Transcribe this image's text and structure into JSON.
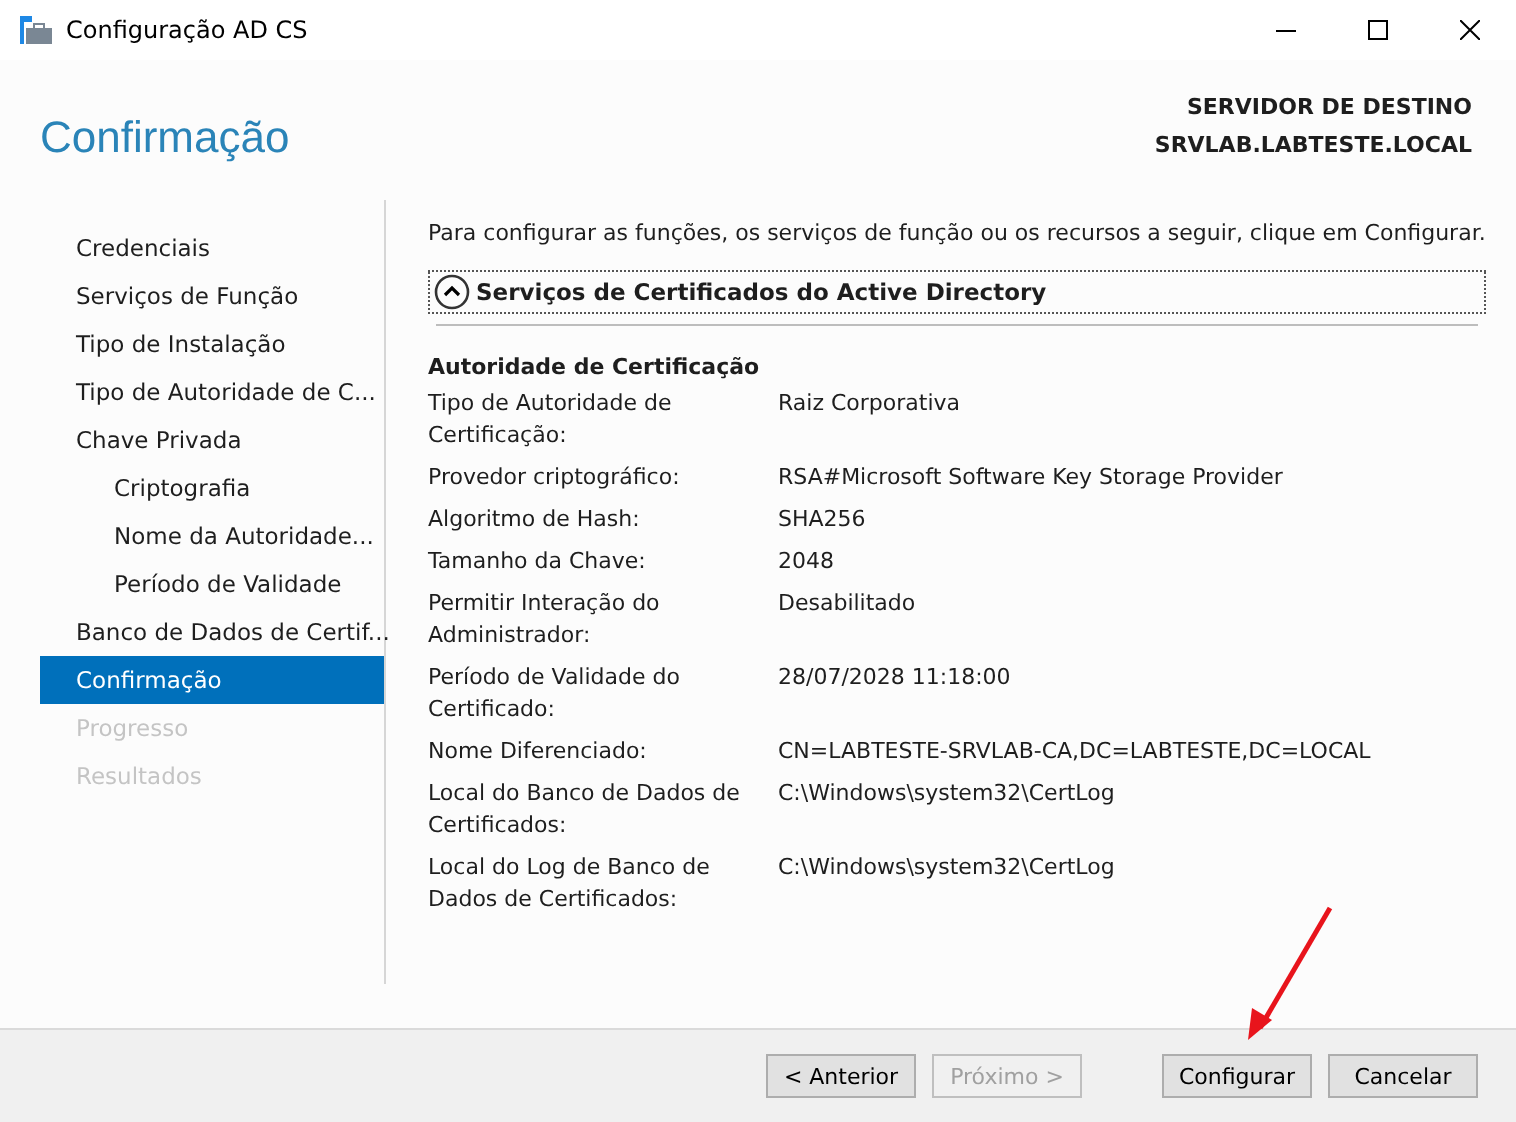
{
  "window": {
    "title": "Configuração AD CS"
  },
  "header": {
    "title": "Confirmação",
    "server_label": "SERVIDOR DE DESTINO",
    "server_name": "SRVLAB.LABTESTE.LOCAL"
  },
  "sidebar": {
    "items": [
      {
        "label": "Credenciais",
        "kind": "step",
        "selected": false,
        "disabled": false
      },
      {
        "label": "Serviços de Função",
        "kind": "step",
        "selected": false,
        "disabled": false
      },
      {
        "label": "Tipo de Instalação",
        "kind": "step",
        "selected": false,
        "disabled": false
      },
      {
        "label": "Tipo de Autoridade de C...",
        "kind": "step",
        "selected": false,
        "disabled": false
      },
      {
        "label": "Chave Privada",
        "kind": "step",
        "selected": false,
        "disabled": false
      },
      {
        "label": "Criptografia",
        "kind": "substep",
        "selected": false,
        "disabled": false
      },
      {
        "label": "Nome da Autoridade...",
        "kind": "substep",
        "selected": false,
        "disabled": false
      },
      {
        "label": "Período de Validade",
        "kind": "substep",
        "selected": false,
        "disabled": false
      },
      {
        "label": "Banco de Dados de Certif...",
        "kind": "step",
        "selected": false,
        "disabled": false
      },
      {
        "label": "Confirmação",
        "kind": "step",
        "selected": true,
        "disabled": false
      },
      {
        "label": "Progresso",
        "kind": "step",
        "selected": false,
        "disabled": true
      },
      {
        "label": "Resultados",
        "kind": "step",
        "selected": false,
        "disabled": true
      }
    ]
  },
  "content": {
    "intro": "Para configurar as funções, os serviços de função ou os recursos a seguir, clique em Configurar.",
    "section": {
      "title": "Serviços de Certificados do Active Directory",
      "expanded": true
    },
    "group_title": "Autoridade de Certificação",
    "properties": [
      {
        "label": "Tipo de Autoridade de Certificação:",
        "value": "Raiz Corporativa"
      },
      {
        "label": "Provedor criptográfico:",
        "value": "RSA#Microsoft Software Key Storage Provider"
      },
      {
        "label": "Algoritmo de Hash:",
        "value": "SHA256"
      },
      {
        "label": "Tamanho da Chave:",
        "value": "2048"
      },
      {
        "label": "Permitir Interação do Administrador:",
        "value": "Desabilitado"
      },
      {
        "label": "Período de Validade do Certificado:",
        "value": "28/07/2028 11:18:00"
      },
      {
        "label": "Nome Diferenciado:",
        "value": "CN=LABTESTE-SRVLAB-CA,DC=LABTESTE,DC=LOCAL"
      },
      {
        "label": "Local do Banco de Dados de Certificados:",
        "value": "C:\\Windows\\system32\\CertLog"
      },
      {
        "label": "Local do Log de Banco de Dados de Certificados:",
        "value": "C:\\Windows\\system32\\CertLog"
      }
    ]
  },
  "buttons": [
    {
      "label": "< Anterior",
      "disabled": false
    },
    {
      "label": "Próximo >",
      "disabled": true
    },
    {
      "label": "Configurar",
      "disabled": false
    },
    {
      "label": "Cancelar",
      "disabled": false
    }
  ]
}
